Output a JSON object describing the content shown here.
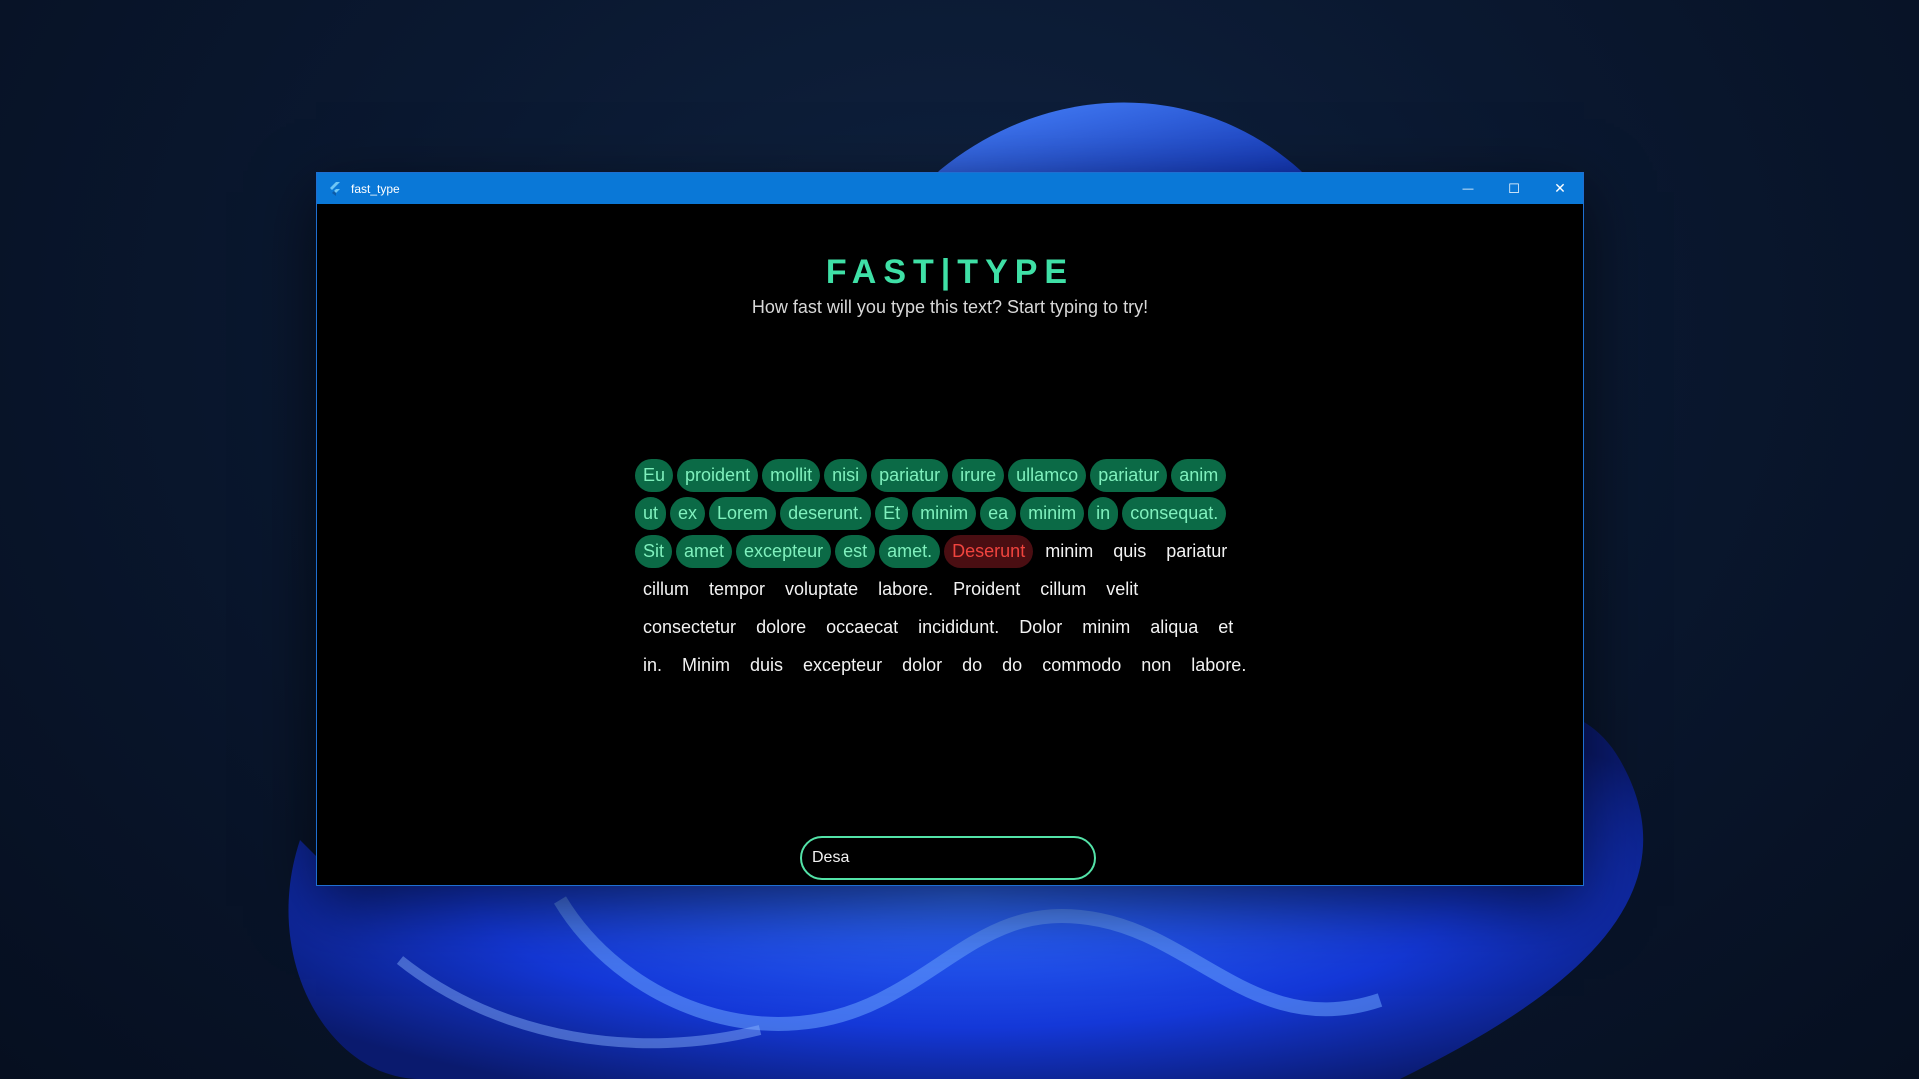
{
  "window": {
    "title": "fast_type",
    "minimize_glyph": "—",
    "maximize_glyph": "☐",
    "close_glyph": "✕"
  },
  "app": {
    "title": "FAST|TYPE",
    "subtitle": "How fast will you type this text? Start typing to try!"
  },
  "words": [
    [
      {
        "text": "Eu",
        "state": "done"
      },
      {
        "text": "proident",
        "state": "done"
      },
      {
        "text": "mollit",
        "state": "done"
      },
      {
        "text": "nisi",
        "state": "done"
      },
      {
        "text": "pariatur",
        "state": "done"
      },
      {
        "text": "irure",
        "state": "done"
      },
      {
        "text": "ullamco",
        "state": "done"
      },
      {
        "text": "pariatur",
        "state": "done"
      },
      {
        "text": "anim",
        "state": "done"
      }
    ],
    [
      {
        "text": "ut",
        "state": "done"
      },
      {
        "text": "ex",
        "state": "done"
      },
      {
        "text": "Lorem",
        "state": "done"
      },
      {
        "text": "deserunt.",
        "state": "done"
      },
      {
        "text": "Et",
        "state": "done"
      },
      {
        "text": "minim",
        "state": "done"
      },
      {
        "text": "ea",
        "state": "done"
      },
      {
        "text": "minim",
        "state": "done"
      },
      {
        "text": "in",
        "state": "done"
      },
      {
        "text": "consequat.",
        "state": "done"
      }
    ],
    [
      {
        "text": "Sit",
        "state": "done"
      },
      {
        "text": "amet",
        "state": "done"
      },
      {
        "text": "excepteur",
        "state": "done"
      },
      {
        "text": "est",
        "state": "done"
      },
      {
        "text": "amet.",
        "state": "done"
      },
      {
        "text": "Deserunt",
        "state": "current"
      },
      {
        "text": "minim",
        "state": "pending"
      },
      {
        "text": "quis",
        "state": "pending"
      },
      {
        "text": "pariatur",
        "state": "pending"
      }
    ],
    [
      {
        "text": "cillum",
        "state": "pending"
      },
      {
        "text": "tempor",
        "state": "pending"
      },
      {
        "text": "voluptate",
        "state": "pending"
      },
      {
        "text": "labore.",
        "state": "pending"
      },
      {
        "text": "Proident",
        "state": "pending"
      },
      {
        "text": "cillum",
        "state": "pending"
      },
      {
        "text": "velit",
        "state": "pending"
      }
    ],
    [
      {
        "text": "consectetur",
        "state": "pending"
      },
      {
        "text": "dolore",
        "state": "pending"
      },
      {
        "text": "occaecat",
        "state": "pending"
      },
      {
        "text": "incididunt.",
        "state": "pending"
      },
      {
        "text": "Dolor",
        "state": "pending"
      },
      {
        "text": "minim",
        "state": "pending"
      },
      {
        "text": "aliqua",
        "state": "pending"
      },
      {
        "text": "et",
        "state": "pending"
      }
    ],
    [
      {
        "text": "in.",
        "state": "pending"
      },
      {
        "text": "Minim",
        "state": "pending"
      },
      {
        "text": "duis",
        "state": "pending"
      },
      {
        "text": "excepteur",
        "state": "pending"
      },
      {
        "text": "dolor",
        "state": "pending"
      },
      {
        "text": "do",
        "state": "pending"
      },
      {
        "text": "do",
        "state": "pending"
      },
      {
        "text": "commodo",
        "state": "pending"
      },
      {
        "text": "non",
        "state": "pending"
      },
      {
        "text": "labore.",
        "state": "pending"
      }
    ]
  ],
  "input": {
    "value": "Desa"
  },
  "colors": {
    "accent": "#3fe0a6",
    "done_bg": "#0b6a46",
    "done_text": "#7ff0bd",
    "error_bg": "#4a0e12",
    "error_text": "#f0443e",
    "titlebar": "#0a78d7"
  }
}
